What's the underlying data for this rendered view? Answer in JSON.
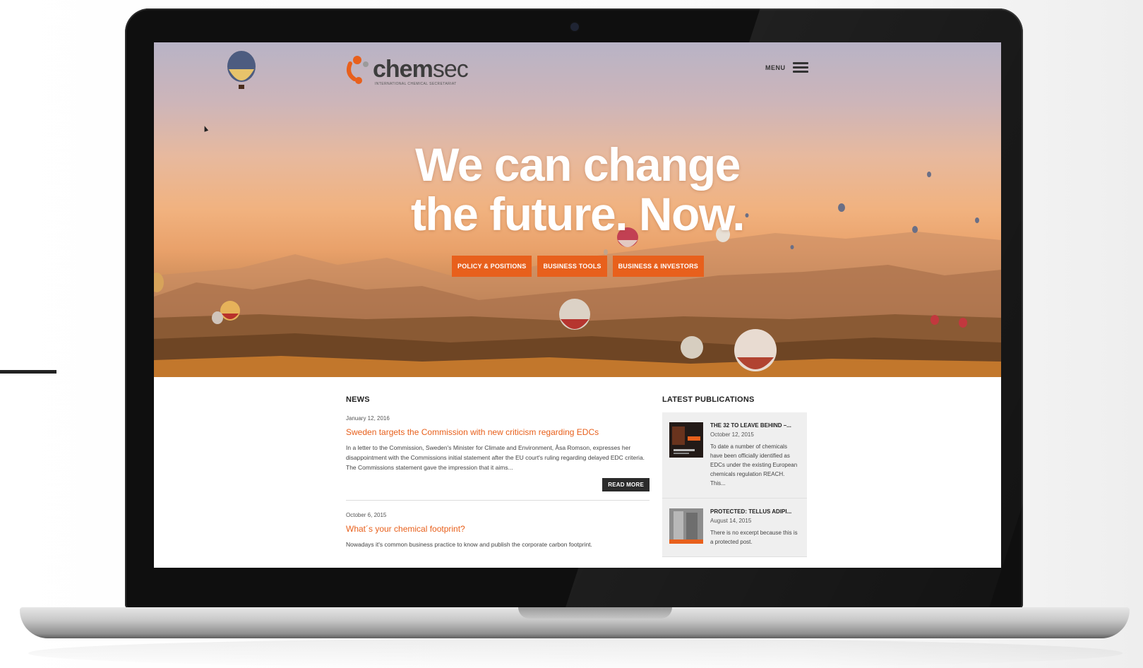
{
  "site": {
    "logo_word_a": "chem",
    "logo_word_b": "sec",
    "logo_tagline": "INTERNATIONAL CHEMICAL SECRETARIAT",
    "menu_label": "MENU"
  },
  "hero": {
    "headline_line1": "We can change",
    "headline_line2": "the future. Now.",
    "ctas": [
      {
        "label": "POLICY & POSITIONS"
      },
      {
        "label": "BUSINESS TOOLS"
      },
      {
        "label": "BUSINESS & INVESTORS"
      }
    ]
  },
  "news": {
    "title": "NEWS",
    "items": [
      {
        "date": "January 12, 2016",
        "title": "Sweden targets the Commission with new criticism regarding EDCs",
        "excerpt": "In a letter to the Commission, Sweden's Minister for Climate and Environment, Åsa Romson, expresses her disappointment with the Commissions initial statement after the EU court's ruling regarding delayed EDC criteria. The Commissions statement gave the impression that it aims...",
        "read_more": "READ MORE"
      },
      {
        "date": "October 6, 2015",
        "title": "What´s your chemical footprint?",
        "excerpt": "Nowadays it's common business practice to know and publish the corporate carbon footprint."
      }
    ]
  },
  "publications": {
    "title": "LATEST PUBLICATIONS",
    "items": [
      {
        "title": "THE 32 TO LEAVE BEHIND –...",
        "date": "October 12, 2015",
        "excerpt": "To date a number of chemicals have been officially identified as EDCs under the existing European chemicals regulation REACH. This..."
      },
      {
        "title": "PROTECTED: TELLUS ADIPI...",
        "date": "August 14, 2015",
        "excerpt": "There is no excerpt because this is a protected post."
      }
    ]
  },
  "colors": {
    "accent": "#e8601c",
    "dark_button": "#2b2b2b",
    "sidebar_bg": "#efefef"
  }
}
